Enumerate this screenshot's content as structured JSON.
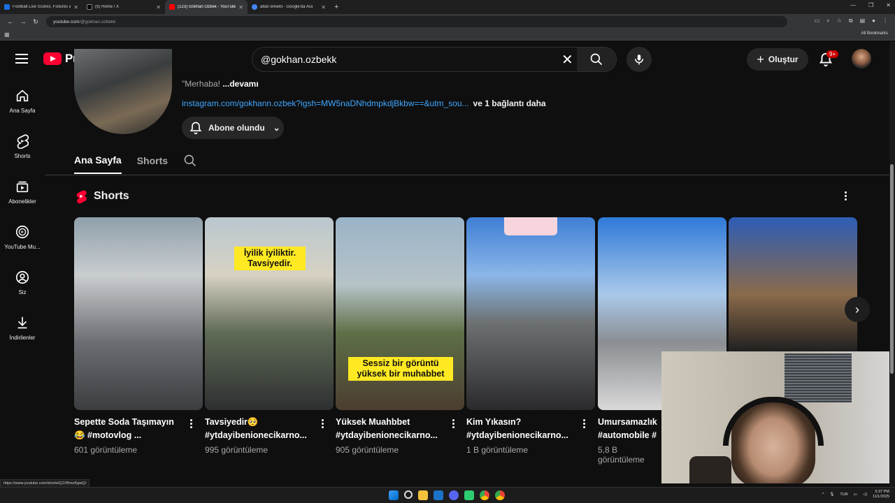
{
  "browser": {
    "tabs": [
      {
        "title": "Football Live Scores, Fixtures &",
        "color": "#1d6fe0",
        "active": false
      },
      {
        "title": "(9) Home / X",
        "color": "#000000",
        "active": false
      },
      {
        "title": "(123) Gökhan Özbek - YouTube",
        "color": "#ff0000",
        "active": true
      },
      {
        "title": "altan erkekli - Google'da Ara",
        "color": "#4285f4",
        "active": false
      }
    ],
    "url_host": "youtube.com",
    "url_path": "/@gokhan.ozbekk",
    "all_bookmarks": "All Bookmarks"
  },
  "header": {
    "logo_text": "Premium",
    "search_value": "@gokhan.ozbekk",
    "create_label": "Oluştur",
    "notif_count": "9+"
  },
  "sidebar": {
    "items": [
      {
        "label": "Ana Sayfa",
        "icon": "home-icon"
      },
      {
        "label": "Shorts",
        "icon": "shorts-icon"
      },
      {
        "label": "Abonelikler",
        "icon": "subscriptions-icon"
      },
      {
        "label": "YouTube Mu...",
        "icon": "youtube-music-icon"
      },
      {
        "label": "Siz",
        "icon": "you-icon"
      },
      {
        "label": "İndirilenler",
        "icon": "download-icon"
      }
    ]
  },
  "channel": {
    "desc_prefix": "\"Merhaba!",
    "desc_more": "...devamı",
    "link": "instagram.com/gokhann.ozbek?igsh=MW5naDNhdmpkdjBkbw==&utm_sou...",
    "more_links": "ve 1 bağlantı daha",
    "subscribed_label": "Abone olundu",
    "tabs": [
      "Ana Sayfa",
      "Shorts"
    ]
  },
  "shorts_section": {
    "title": "Shorts",
    "items": [
      {
        "title1": "Sepette Soda Taşımayın",
        "title2": "😂 #motovlog ...",
        "views": "601 görüntüleme",
        "overlay": ""
      },
      {
        "title1": "Tavsiyedir🥺",
        "title2": "#ytdayibenionecikarno...",
        "views": "995 görüntüleme",
        "overlay": "İyilik iyiliktir. Tavsiyedir."
      },
      {
        "title1": "Yüksek Muahbbet",
        "title2": "#ytdayibenionecikarno...",
        "views": "905 görüntüleme",
        "overlay": "Sessiz bir görüntü yüksek bir muhabbet"
      },
      {
        "title1": "Kim Yıkasın?",
        "title2": "#ytdayibenionecikarno...",
        "views": "1 B görüntüleme",
        "overlay": ""
      },
      {
        "title1": "Umursamazlık",
        "title2": "#automobile #",
        "views": "5,8 B görüntüleme",
        "overlay": ""
      }
    ]
  },
  "status_url": "https://www.youtube.com/shorts/Q1VBmoKgwQI",
  "tray": {
    "lang": "TUR",
    "time": "5:37 PM",
    "date": "11/1/2025"
  }
}
